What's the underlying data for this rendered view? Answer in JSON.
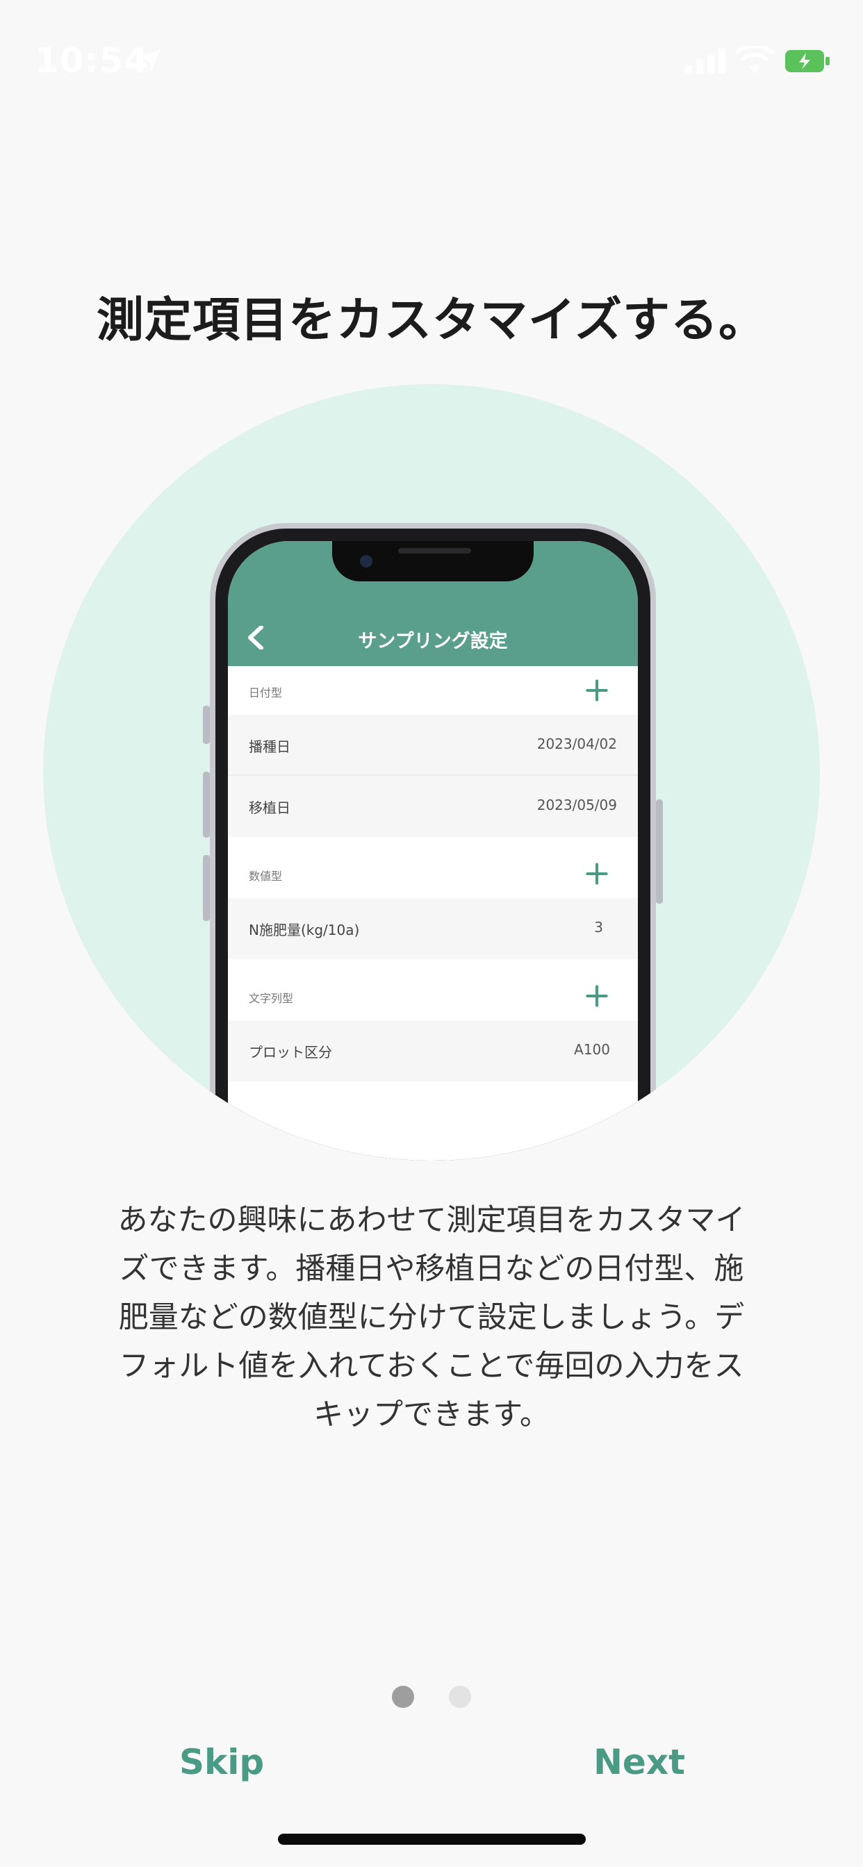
{
  "status_bar": {
    "time": "10:54",
    "icons": [
      "location-arrow-icon",
      "cellular-signal-icon",
      "wifi-icon",
      "battery-charging-icon"
    ]
  },
  "title": "測定項目をカスタマイズする。",
  "illustration": {
    "screen_title": "サンプリング設定",
    "sections": [
      {
        "label": "日付型",
        "rows": [
          {
            "label": "播種日",
            "value": "2023/04/02"
          },
          {
            "label": "移植日",
            "value": "2023/05/09"
          }
        ]
      },
      {
        "label": "数値型",
        "rows": [
          {
            "label": "N施肥量(kg/10a)",
            "value": "3"
          }
        ]
      },
      {
        "label": "文字列型",
        "rows": [
          {
            "label": "プロット区分",
            "value": "A100"
          }
        ]
      }
    ]
  },
  "description": {
    "lines": [
      "あなたの興味にあわせて測定項目をカスタマイ",
      "ズできます。播種日や移植日などの日付型、施",
      "肥量などの数値型に分けて設定しましょう。デ",
      "フォルト値を入れておくことで毎回の入力をス",
      "キップできます。"
    ]
  },
  "pager": {
    "current": 1,
    "total": 2
  },
  "buttons": {
    "skip": "Skip",
    "next": "Next"
  },
  "colors": {
    "accent": "#4a9a86",
    "header": "#5a9f8c",
    "circle": "#dff3ed",
    "background": "#f8f8f8"
  }
}
